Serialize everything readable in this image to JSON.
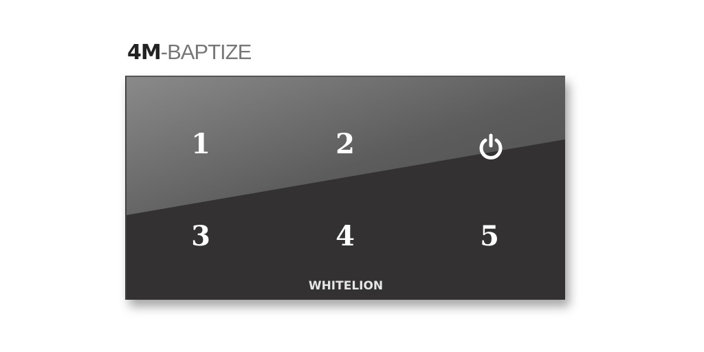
{
  "title": {
    "model": "4M",
    "separator": "-",
    "series": "BAPTIZE"
  },
  "panel": {
    "keys": [
      "1",
      "2",
      "3",
      "4",
      "5"
    ],
    "power_icon": "power-icon",
    "brand": "WHITELION",
    "color": "#333132"
  }
}
